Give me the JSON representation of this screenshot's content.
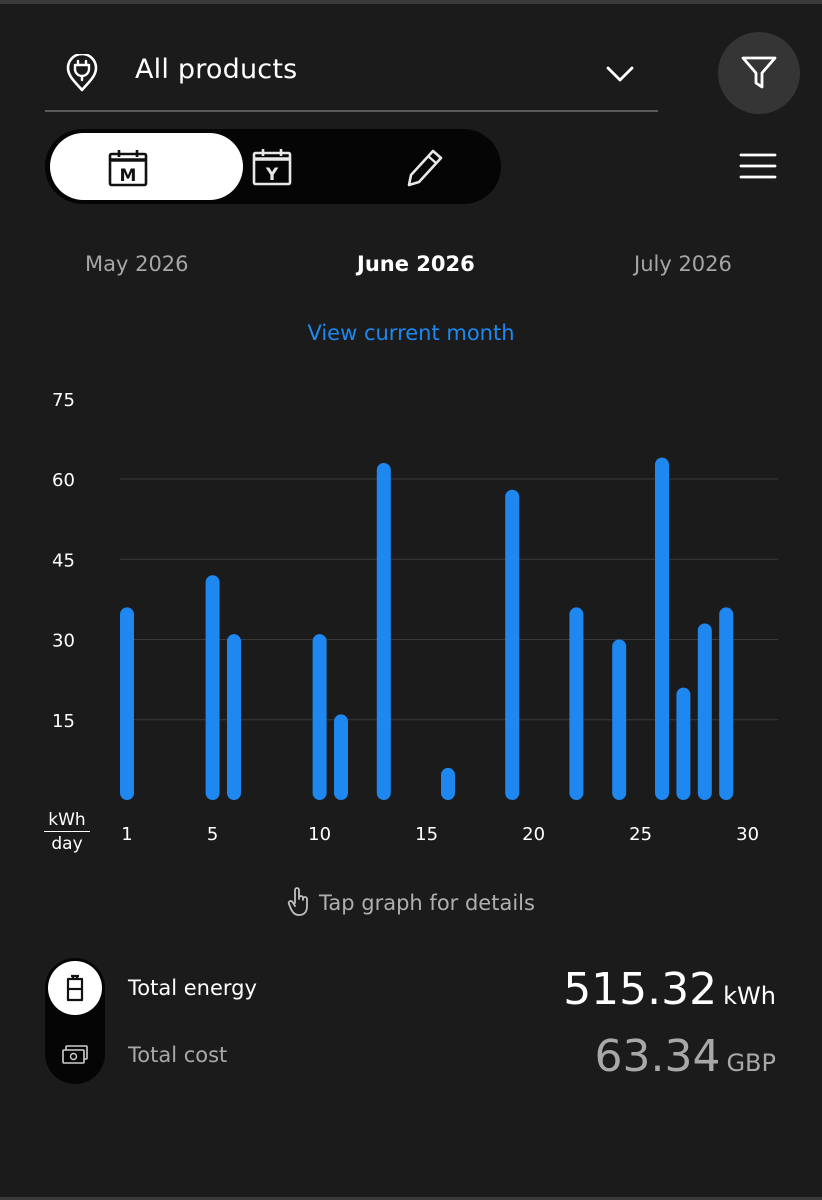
{
  "selector": {
    "label": "All products"
  },
  "toggle": {
    "month_letter": "M",
    "year_letter": "Y"
  },
  "months": {
    "previous": "May 2026",
    "current": "June 2026",
    "next": "July 2026"
  },
  "view_current_label": "View current month",
  "unit": {
    "top": "kWh",
    "bottom": "day"
  },
  "tap_hint": "Tap graph for details",
  "totals": {
    "energy_label": "Total energy",
    "energy_value": "515.32",
    "energy_unit": "kWh",
    "cost_label": "Total cost",
    "cost_value": "63.34",
    "cost_unit": "GBP"
  },
  "colors": {
    "accent": "#1e88f0",
    "background": "#1b1b1b",
    "bar": "#1e88f0"
  },
  "chart_data": {
    "type": "bar",
    "ylim": [
      0,
      75
    ],
    "yticks": [
      15,
      30,
      45,
      60,
      75
    ],
    "xticks": [
      1,
      5,
      10,
      15,
      20,
      25,
      30
    ],
    "grid": true,
    "x": [
      1,
      2,
      3,
      4,
      5,
      6,
      7,
      8,
      9,
      10,
      11,
      12,
      13,
      14,
      15,
      16,
      17,
      18,
      19,
      20,
      21,
      22,
      23,
      24,
      25,
      26,
      27,
      28,
      29,
      30
    ],
    "values": [
      36,
      0,
      0,
      0,
      42,
      31,
      0,
      0,
      0,
      31,
      16,
      0,
      63,
      0,
      0,
      6,
      0,
      0,
      58,
      0,
      0,
      36,
      0,
      30,
      0,
      64,
      21,
      33,
      36,
      0
    ]
  }
}
